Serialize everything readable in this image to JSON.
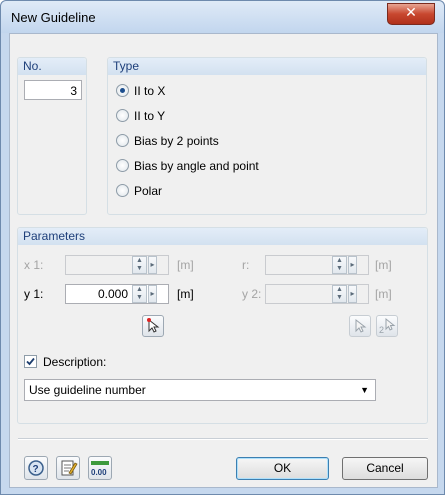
{
  "window": {
    "title": "New Guideline",
    "close_glyph": "✕"
  },
  "no_group": {
    "label": "No.",
    "value": "3"
  },
  "type_group": {
    "label": "Type",
    "options": [
      {
        "label": "II to X",
        "checked": true
      },
      {
        "label": "II to Y",
        "checked": false
      },
      {
        "label": "Bias by 2 points",
        "checked": false
      },
      {
        "label": "Bias by angle and point",
        "checked": false
      },
      {
        "label": "Polar",
        "checked": false
      }
    ]
  },
  "parameters": {
    "label": "Parameters",
    "x1": {
      "label": "x 1:",
      "value": "",
      "unit": "[m]",
      "enabled": false
    },
    "y1": {
      "label": "y 1:",
      "value": "0.000",
      "unit": "[m]",
      "enabled": true
    },
    "r": {
      "label": "r:",
      "value": "",
      "unit": "[m]",
      "enabled": false
    },
    "y2": {
      "label": "y 2:",
      "value": "",
      "unit": "[m]",
      "enabled": false
    },
    "pick_icon_label": "2"
  },
  "description": {
    "label": "Description:",
    "checked": true,
    "selected": "Use guideline number"
  },
  "footer": {
    "units_icon_text": "0.00",
    "ok_label": "OK",
    "cancel_label": "Cancel"
  },
  "colors": {
    "accent": "#1e3f7a",
    "title_bar": "#c2d6ee",
    "close": "#c8472f"
  }
}
